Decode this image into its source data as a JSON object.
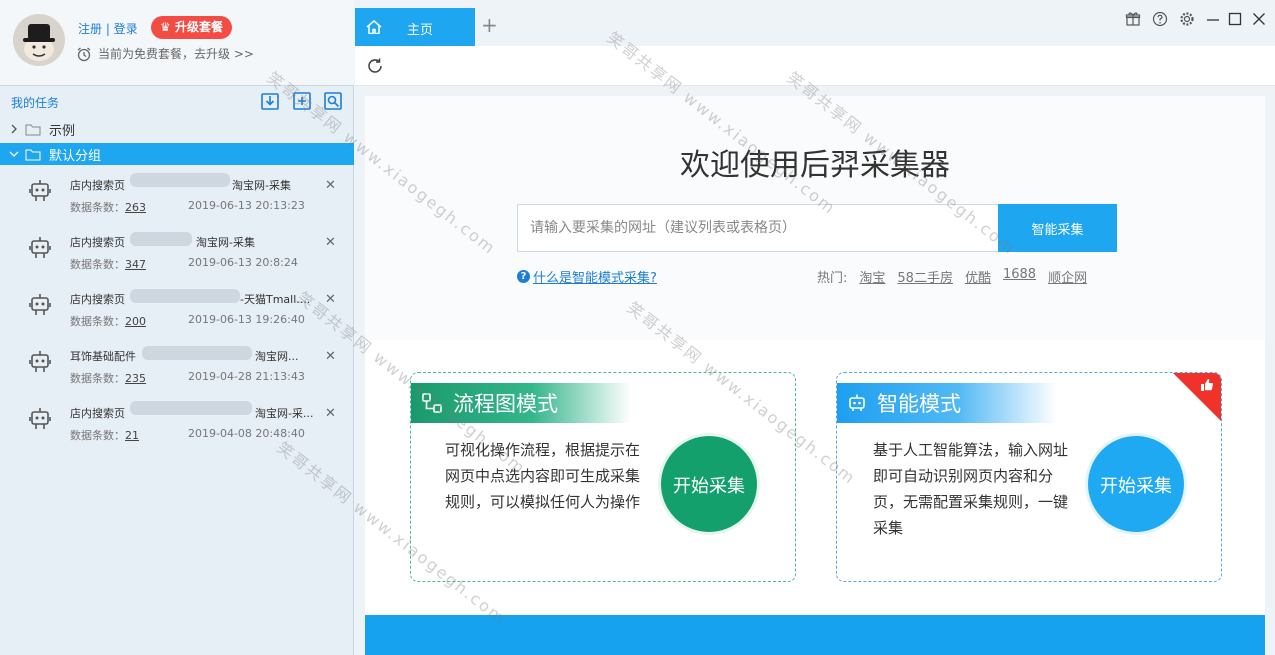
{
  "profile": {
    "register_login": "注册 | 登录",
    "upgrade": "升级套餐",
    "plan_text": "当前为免费套餐，去升级 >>"
  },
  "tasks_panel": {
    "title": "我的任务",
    "folders": [
      {
        "label": "示例",
        "expanded": false
      },
      {
        "label": "默认分组",
        "expanded": true
      }
    ],
    "items": [
      {
        "name_prefix": "店内搜索页",
        "name_suffix": "淘宝网-采集",
        "count_label": "数据条数：",
        "count": "263",
        "time": "2019-06-13 20:13:23"
      },
      {
        "name_prefix": "店内搜索页",
        "name_suffix": "淘宝网-采集",
        "count_label": "数据条数：",
        "count": "347",
        "time": "2019-06-13 20:8:24"
      },
      {
        "name_prefix": "店内搜索页",
        "name_suffix": "-天猫Tmall....",
        "count_label": "数据条数：",
        "count": "200",
        "time": "2019-06-13 19:26:40"
      },
      {
        "name_prefix": "耳饰基础配件",
        "name_suffix": "淘宝网...",
        "count_label": "数据条数：",
        "count": "235",
        "time": "2019-04-28 21:13:43"
      },
      {
        "name_prefix": "店内搜索页",
        "name_suffix": "淘宝网-采...",
        "count_label": "数据条数：",
        "count": "21",
        "time": "2019-04-08 20:48:40"
      }
    ]
  },
  "tabs": {
    "home": "主页",
    "plus": "+"
  },
  "hero": {
    "title": "欢迎使用后羿采集器",
    "url_placeholder": "请输入要采集的网址（建议列表或表格页）",
    "smart_button": "智能采集",
    "help_link": "什么是智能模式采集?",
    "hot_label": "热门:",
    "hot_sites": [
      "淘宝",
      "58二手房",
      "优酷",
      "1688",
      "顺企网"
    ]
  },
  "cards": {
    "flow": {
      "title": "流程图模式",
      "desc": "可视化操作流程，根据提示在网页中点选内容即可生成采集规则，可以模拟任何人为操作",
      "start": "开始采集"
    },
    "smart": {
      "title": "智能模式",
      "desc": "基于人工智能算法，输入网址即可自动识别网页内容和分页，无需配置采集规则，一键采集",
      "start": "开始采集"
    }
  },
  "watermark": {
    "text_cn": "笑哥共享网",
    "text_url": "www.xiaogegh.com"
  },
  "colors": {
    "accent": "#1ea6f1",
    "green": "#14a06c",
    "upgrade_red": "#f34c44"
  }
}
